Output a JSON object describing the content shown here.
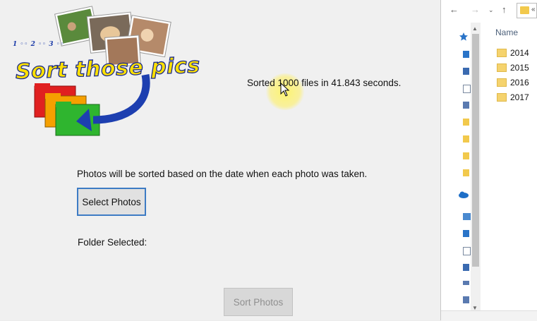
{
  "app": {
    "logo": {
      "brand_text": "1 ◦◦ 2 ◦◦ 3 ◦◦",
      "title": "Sort those pics"
    },
    "status_text": "Sorted 1000 files in 41.843 seconds.",
    "info_text": "Photos will be sorted based on the date when each photo was taken.",
    "select_button_label": "Select Photos",
    "folder_selected_label": "Folder Selected:",
    "sort_button_label": "Sort Photos",
    "sort_button_enabled": false
  },
  "explorer": {
    "address_text": "«",
    "column_header": "Name",
    "folders": [
      "2014",
      "2015",
      "2016",
      "2017"
    ],
    "nav_icons": [
      "back-arrow-icon",
      "forward-arrow-icon",
      "chevron-down-icon",
      "up-arrow-icon"
    ]
  },
  "colors": {
    "window_bg": "#f0f0f0",
    "select_button_border": "#3d7bc4",
    "logo_yellow": "#ffe000",
    "logo_blue": "#1b2b8a",
    "folder_yellow": "#f5d36e"
  }
}
